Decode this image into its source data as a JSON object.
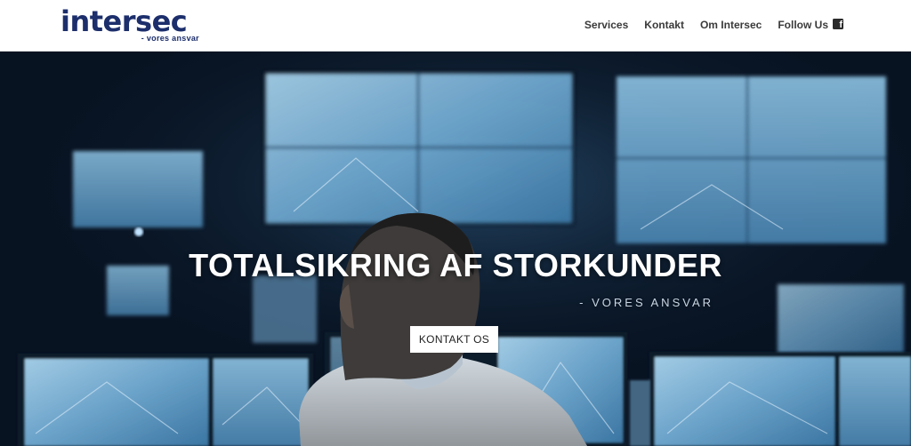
{
  "brand": {
    "name": "intersec",
    "tagline": "- vores ansvar"
  },
  "nav": [
    {
      "label": "Services"
    },
    {
      "label": "Kontakt"
    },
    {
      "label": "Om Intersec"
    },
    {
      "label": "Follow Us",
      "icon": "facebook-icon"
    }
  ],
  "hero": {
    "title": "TOTALSIKRING AF STORKUNDER",
    "subtitle": "- VORES ANSVAR",
    "cta_label": "KONTAKT OS"
  },
  "colors": {
    "brand_navy": "#1c2e6b",
    "hero_dark": "#0a1626",
    "monitor_glow": "#7fb8dc"
  }
}
